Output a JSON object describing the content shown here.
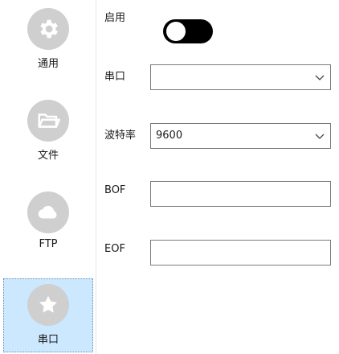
{
  "sidebar": {
    "items": [
      {
        "label": "通用",
        "icon": "gear-icon"
      },
      {
        "label": "文件",
        "icon": "folder-icon"
      },
      {
        "label": "FTP",
        "icon": "cloud-icon"
      },
      {
        "label": "串口",
        "icon": "star-icon",
        "selected": true
      }
    ]
  },
  "form": {
    "enable_label": "启用",
    "enable_state": "off",
    "serial_port_label": "串口",
    "serial_port_value": "",
    "baud_rate_label": "波特率",
    "baud_rate_value": "9600",
    "bof_label": "BOF",
    "bof_value": "",
    "eof_label": "EOF",
    "eof_value": ""
  },
  "colors": {
    "selected_bg": "#cce8ff",
    "icon_circle": "#cfcfcf",
    "toggle_bg": "#000000"
  }
}
